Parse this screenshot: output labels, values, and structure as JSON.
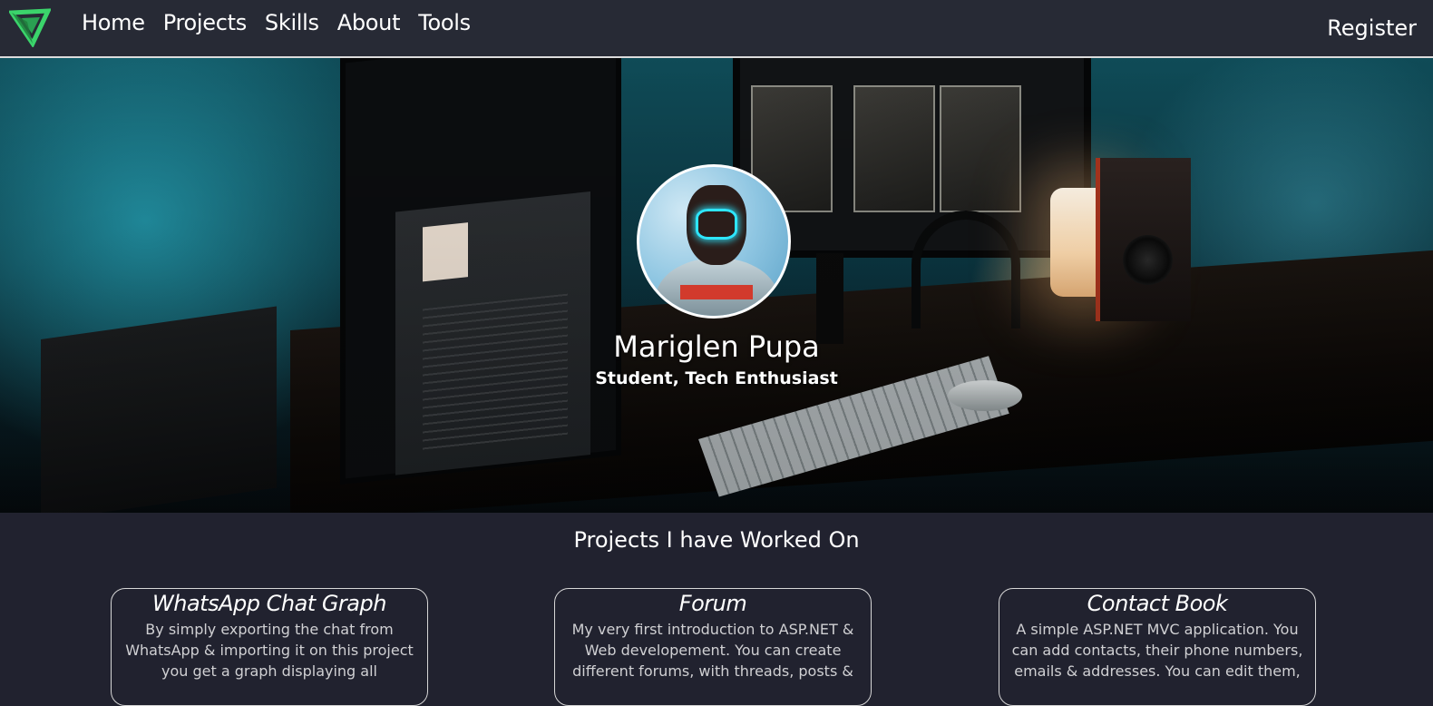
{
  "nav": {
    "logo_icon": "triangle-logo-icon",
    "links": [
      "Home",
      "Projects",
      "Skills",
      "About",
      "Tools"
    ],
    "register_label": "Register"
  },
  "hero": {
    "name": "Mariglen Pupa",
    "subtitle": "Student, Tech Enthusiast",
    "avatar_icon": "profile-avatar"
  },
  "projects": {
    "title": "Projects I have Worked On",
    "cards": [
      {
        "title": "WhatsApp Chat Graph",
        "description": "By simply exporting the chat from WhatsApp & importing it on this project you get a graph displaying all"
      },
      {
        "title": "Forum",
        "description": "My very first introduction to ASP.NET & Web developement. You can create different forums, with threads, posts &"
      },
      {
        "title": "Contact Book",
        "description": "A simple ASP.NET MVC application. You can add contacts, their phone numbers, emails & addresses. You can edit them,"
      }
    ]
  },
  "colors": {
    "nav_background": "#272a35",
    "page_background": "#21222f",
    "logo_green": "#3bd46b",
    "text": "#ffffff"
  }
}
